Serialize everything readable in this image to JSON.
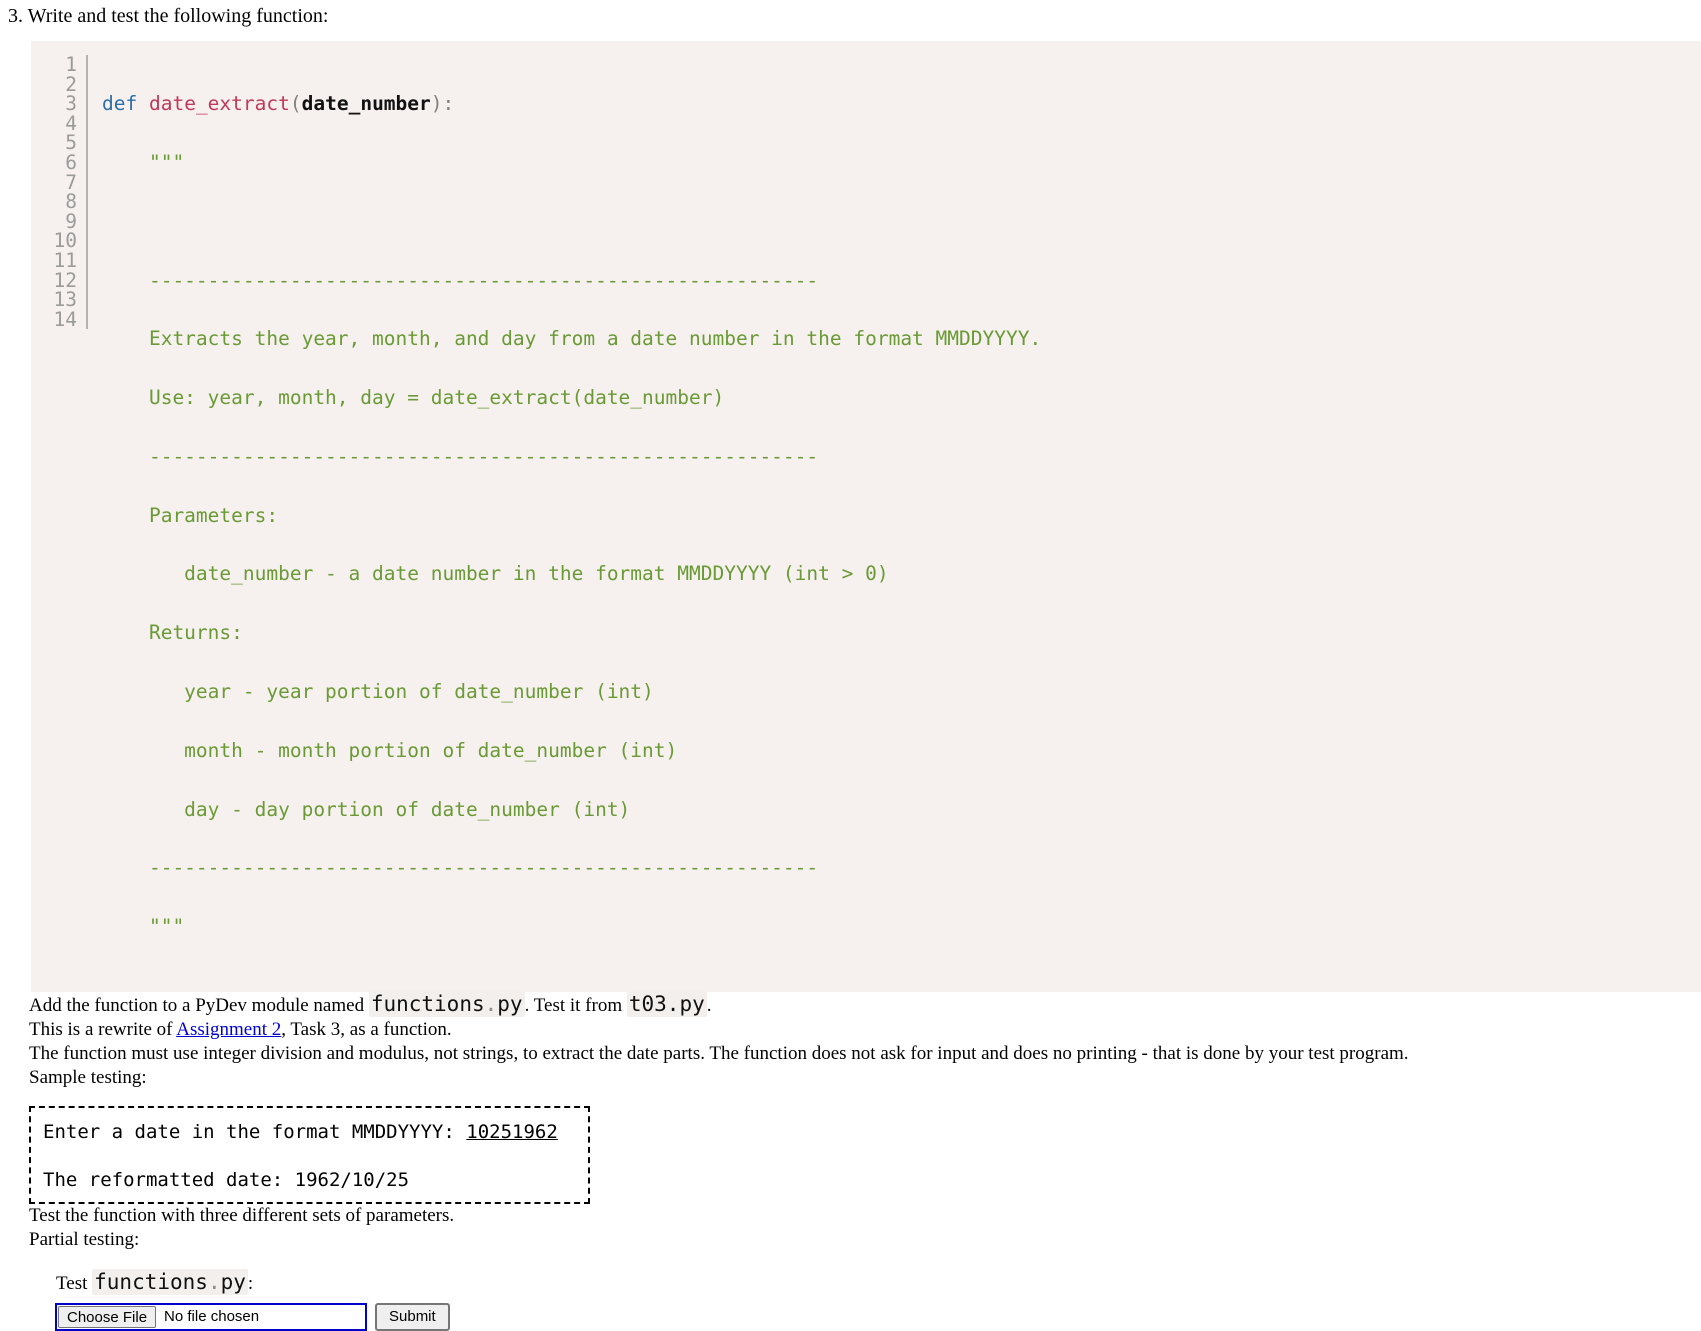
{
  "heading": {
    "number": "3.",
    "text": "Write and test the following function:"
  },
  "code_block": {
    "line_numbers": [
      "1",
      "2",
      "3",
      "4",
      "5",
      "6",
      "7",
      "8",
      "9",
      "10",
      "11",
      "12",
      "13",
      "14"
    ],
    "colors": {
      "background": "#f6f1ee",
      "gutter_text": "#9b9b9b",
      "keyword": "#2b6ea8",
      "function_name": "#c0395a",
      "parameter": "#111111",
      "punctuation": "#808080",
      "docstring": "#6a9a35"
    },
    "line1": {
      "keyword": "def",
      "space": " ",
      "function_name": "date_extract",
      "open_paren": "(",
      "parameter": "date_number",
      "close_paren": ")",
      "colon": ":"
    },
    "docstring_lines": [
      "    \"\"\"",
      "",
      "    ---------------------------------------------------------",
      "    Extracts the year, month, and day from a date number in the format MMDDYYYY.",
      "    Use: year, month, day = date_extract(date_number)",
      "    ---------------------------------------------------------",
      "    Parameters:",
      "       date_number - a date number in the format MMDDYYYY (int > 0)",
      "    Returns:",
      "       year - year portion of date_number (int)",
      "       month - month portion of date_number (int)",
      "       day - day portion of date_number (int)",
      "    ---------------------------------------------------------",
      "    \"\"\""
    ]
  },
  "paragraphs": {
    "add_prefix": "Add the function to a PyDev module named ",
    "module_name_main": "functions",
    "module_name_dot": ".",
    "module_name_ext": "py",
    "add_middle": ". Test it from ",
    "test_module": "t03.py",
    "add_suffix": ".",
    "rewrite_prefix": "This is a rewrite of ",
    "rewrite_link": "Assignment 2",
    "rewrite_suffix": ", Task 3, as a function.",
    "must_use": "The function must use integer division and modulus, not strings, to extract the date parts. The function does not ask for input and does no printing - that is done by your test program.",
    "sample_testing_label": "Sample testing:",
    "three_sets": "Test the function with three different sets of parameters.",
    "partial_testing_label": "Partial testing:"
  },
  "sample_output": {
    "prompt": "Enter a date in the format MMDDYYYY: ",
    "user_input": "10251962",
    "blank": "",
    "result": "The reformatted date: 1962/10/25"
  },
  "upload_form": {
    "label_prefix": "Test ",
    "label_file_main": "functions",
    "label_file_dot": ".",
    "label_file_ext": "py",
    "label_suffix": ":",
    "choose_file_button": "Choose File",
    "file_status": "No file chosen",
    "submit_button": "Submit",
    "focus_color": "#0000cc"
  }
}
